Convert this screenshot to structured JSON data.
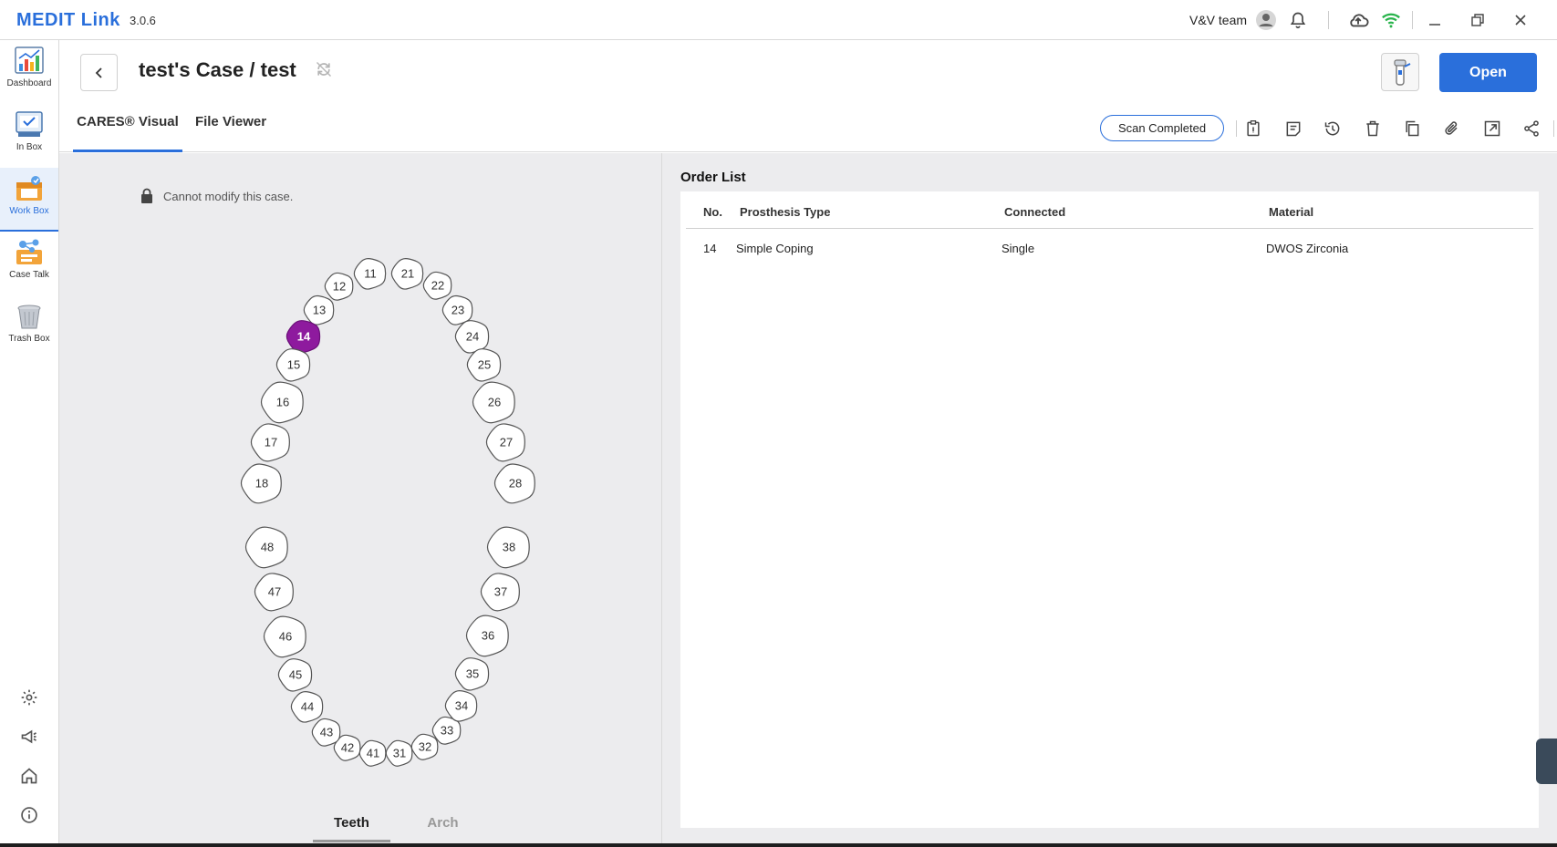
{
  "app": {
    "brand": "MEDIT Link",
    "version": "3.0.6",
    "team": "V&V team"
  },
  "sidenav": {
    "items": [
      {
        "label": "Dashboard",
        "icon": "dashboard-icon"
      },
      {
        "label": "In Box",
        "icon": "inbox-icon"
      },
      {
        "label": "Work Box",
        "icon": "workbox-icon",
        "active": true
      },
      {
        "label": "Case Talk",
        "icon": "case-talk-icon"
      },
      {
        "label": "Trash Box",
        "icon": "trash-box-icon"
      }
    ],
    "bottom_icons": [
      "settings-icon",
      "announcement-icon",
      "home-icon",
      "info-icon"
    ]
  },
  "case": {
    "title": "test's Case / test",
    "open_label": "Open",
    "tabs": [
      {
        "label": "CARES® Visual",
        "active": true
      },
      {
        "label": "File Viewer",
        "active": false
      }
    ],
    "status": "Scan Completed",
    "actions": [
      "clipboard-icon",
      "note-icon",
      "history-icon",
      "delete-icon",
      "copy-icon",
      "attach-icon",
      "export-icon",
      "share-icon",
      "support-icon"
    ]
  },
  "visual": {
    "lock_message": "Cannot modify this case.",
    "selected_tooth": "14",
    "selected_color": "#8e1a9e",
    "sub_tabs": [
      {
        "label": "Teeth",
        "active": true
      },
      {
        "label": "Arch",
        "active": false
      }
    ],
    "teeth": [
      "11",
      "12",
      "13",
      "14",
      "15",
      "16",
      "17",
      "18",
      "21",
      "22",
      "23",
      "24",
      "25",
      "26",
      "27",
      "28",
      "31",
      "32",
      "33",
      "34",
      "35",
      "36",
      "37",
      "38",
      "41",
      "42",
      "43",
      "44",
      "45",
      "46",
      "47",
      "48"
    ]
  },
  "order_list": {
    "title": "Order List",
    "columns": [
      "No.",
      "Prosthesis Type",
      "Connected",
      "Material"
    ],
    "rows": [
      [
        "14",
        "Simple Coping",
        "Single",
        "DWOS Zirconia"
      ]
    ]
  },
  "colors": {
    "accent": "#2a6fdb",
    "panel_bg": "#ececee"
  }
}
